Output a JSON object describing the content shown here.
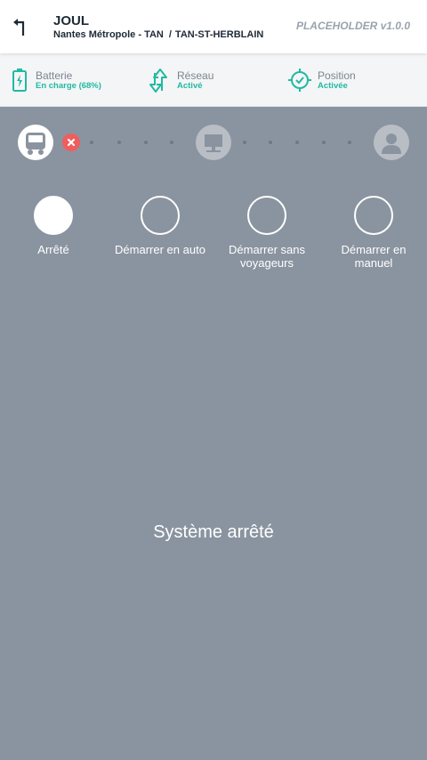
{
  "header": {
    "title": "JOUL",
    "network": "Nantes Métropole - TAN",
    "separator": "/",
    "stop": "TAN-ST-HERBLAIN",
    "version": "PLACEHOLDER v1.0.0",
    "back_icon": "arrow-back-icon"
  },
  "status_bar": {
    "items": [
      {
        "label": "Batterie",
        "value": "En charge (68%)",
        "icon": "battery-charging-icon"
      },
      {
        "label": "Réseau",
        "value": "Activé",
        "icon": "network-arrows-icon"
      },
      {
        "label": "Position",
        "value": "Activée",
        "icon": "location-target-icon"
      }
    ],
    "accent_color": "#22b9a3"
  },
  "progress": {
    "steps": [
      {
        "icon": "bus-icon",
        "state": "active"
      },
      {
        "icon": "screen-icon",
        "state": "inactive"
      },
      {
        "icon": "user-icon",
        "state": "inactive"
      }
    ],
    "error_icon": "close-icon",
    "error_color": "#f05d5e"
  },
  "modes": [
    {
      "label": "Arrêté",
      "selected": true
    },
    {
      "label": "Démarrer en auto",
      "selected": false
    },
    {
      "label": "Démarrer sans voyageurs",
      "selected": false
    },
    {
      "label": "Démarrer en manuel",
      "selected": false
    }
  ],
  "system_status": "Système arrêté",
  "background_color": "#8a94a0"
}
